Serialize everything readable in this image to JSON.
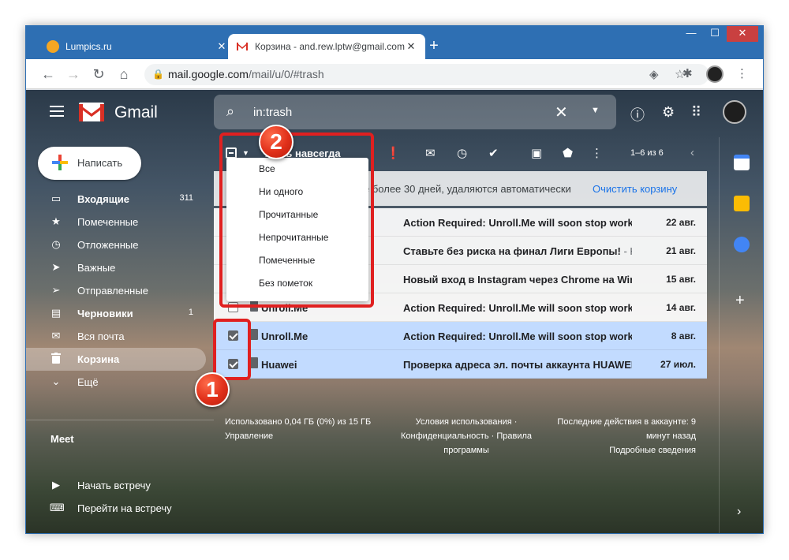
{
  "browser": {
    "tabs": [
      {
        "title": "Lumpics.ru",
        "favicon_color": "#f4a623"
      },
      {
        "title": "Корзина - and.rew.lptw@gmail.com",
        "favicon_color": "#d93025"
      }
    ],
    "close_glyph": "✕",
    "new_tab_glyph": "+",
    "url_host": "mail.google.com",
    "url_path": "/mail/u/0/#trash"
  },
  "gmail": {
    "brand": "Gmail",
    "search_value": "in:trash",
    "compose_label": "Написать",
    "nav": [
      {
        "label": "Входящие",
        "count": "311",
        "icon": "inbox-icon",
        "glyph": "▭",
        "bold": true
      },
      {
        "label": "Помеченные",
        "count": "",
        "icon": "star-icon",
        "glyph": "★",
        "bold": false
      },
      {
        "label": "Отложенные",
        "count": "",
        "icon": "clock-icon",
        "glyph": "◷",
        "bold": false
      },
      {
        "label": "Важные",
        "count": "",
        "icon": "important-icon",
        "glyph": "➤",
        "bold": false
      },
      {
        "label": "Отправленные",
        "count": "",
        "icon": "send-icon",
        "glyph": "➢",
        "bold": false
      },
      {
        "label": "Черновики",
        "count": "1",
        "icon": "draft-icon",
        "glyph": "▤",
        "bold": true
      },
      {
        "label": "Вся почта",
        "count": "",
        "icon": "all-mail-icon",
        "glyph": "✉",
        "bold": false
      },
      {
        "label": "Корзина",
        "count": "",
        "icon": "trash-icon",
        "glyph": "🗑",
        "bold": false,
        "active": true
      },
      {
        "label": "Ещё",
        "count": "",
        "icon": "chevron-down-icon",
        "glyph": "⌄",
        "bold": false
      }
    ],
    "meet": {
      "title": "Meet",
      "items": [
        {
          "label": "Начать встречу",
          "glyph": "▶"
        },
        {
          "label": "Перейти на встречу",
          "glyph": "⌨"
        }
      ]
    },
    "toolbar": {
      "delete_forever": "…ить навсегда",
      "paging": "1–6 из 6"
    },
    "notice": {
      "text": "е более 30 дней, удаляются автоматически",
      "link": "Очистить корзину"
    },
    "select_menu": [
      "Все",
      "Ни одного",
      "Прочитанные",
      "Непрочитанные",
      "Помеченные",
      "Без пометок"
    ],
    "emails": [
      {
        "sender": "",
        "subject": "Action Required: Unroll.Me will soon stop worki…",
        "snippet": "",
        "date": "22 авг.",
        "selected": false
      },
      {
        "sender": "",
        "subject": "Ставьте без риска на финал Лиги Европы!",
        "snippet": " - Н…",
        "date": "21 авг.",
        "selected": false
      },
      {
        "sender": "",
        "subject": "Новый вход в Instagram через Chrome на Win…",
        "snippet": "",
        "date": "15 авг.",
        "selected": false
      },
      {
        "sender": "Unroll.Me",
        "subject": "Action Required: Unroll.Me will soon stop worki…",
        "snippet": "",
        "date": "14 авг.",
        "selected": false
      },
      {
        "sender": "Unroll.Me",
        "subject": "Action Required: Unroll.Me will soon stop worki…",
        "snippet": "",
        "date": "8 авг.",
        "selected": true
      },
      {
        "sender": "Huawei",
        "subject": "Проверка адреса эл. почты аккаунта HUAWEI",
        "snippet": " -",
        "date": "27 июл.",
        "selected": true
      }
    ],
    "footer": {
      "storage": "Использовано 0,04 ГБ (0%) из 15 ГБ",
      "manage": "Управление",
      "terms_line1": "Условия использования ·",
      "terms_line2": "Конфиденциальность · Правила",
      "terms_line3": "программы",
      "activity_line1": "Последние действия в аккаунте: 9",
      "activity_line2": "минут назад",
      "activity_line3": "Подробные сведения"
    }
  },
  "annotations": {
    "badge_1": "1",
    "badge_2": "2",
    "color": "#e02020"
  }
}
